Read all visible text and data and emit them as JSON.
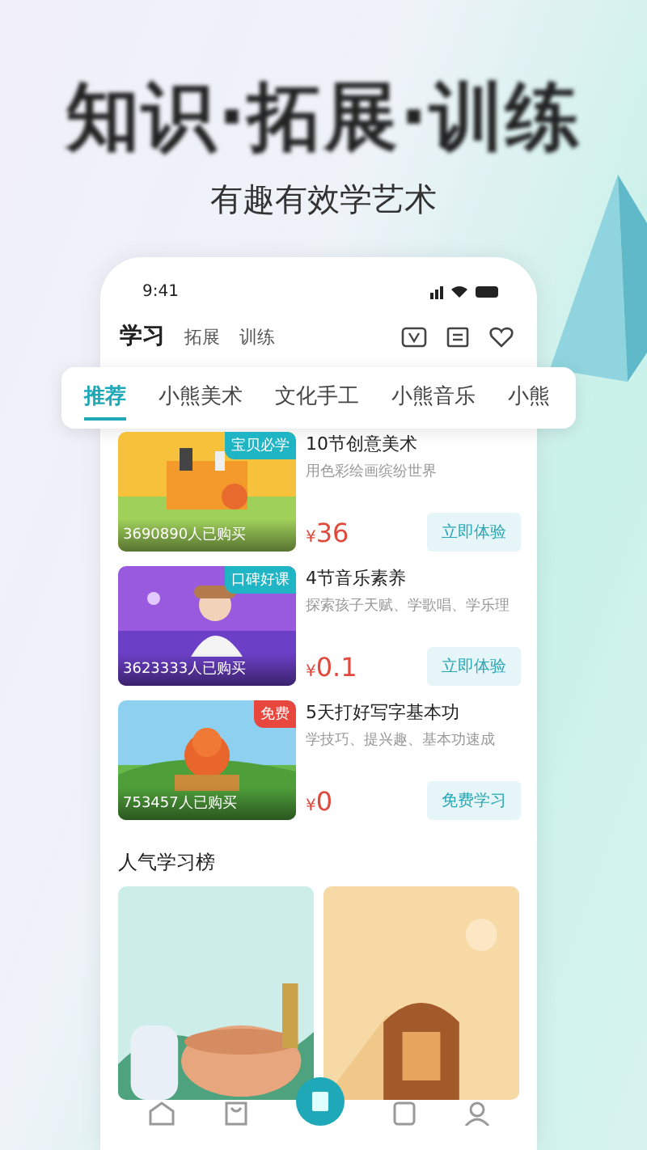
{
  "headline": "知识·拓展·训练",
  "subtitle": "有趣有效学艺术",
  "status_bar": {
    "time": "9:41"
  },
  "top_tabs": [
    {
      "label": "学习",
      "selected": true
    },
    {
      "label": "拓展",
      "selected": false
    },
    {
      "label": "训练",
      "selected": false
    }
  ],
  "categories": [
    {
      "label": "推荐",
      "selected": true
    },
    {
      "label": "小熊美术",
      "selected": false
    },
    {
      "label": "文化手工",
      "selected": false
    },
    {
      "label": "小熊音乐",
      "selected": false
    },
    {
      "label": "小熊",
      "selected": false
    }
  ],
  "courses": [
    {
      "badge": "宝贝必学",
      "color": "#1fb5c4",
      "buyers": "3690890人已购买",
      "title": "10节创意美术",
      "desc": "用色彩绘画缤纷世界",
      "currency": "¥",
      "price": "36",
      "action": "立即体验"
    },
    {
      "badge": "口碑好课",
      "color": "#1fb5c4",
      "buyers": "3623333人已购买",
      "title": "4节音乐素养",
      "desc": "探索孩子天赋、学歌唱、学乐理",
      "currency": "¥",
      "price": "0.1",
      "action": "立即体验"
    },
    {
      "badge": "免费",
      "color": "#e8473e",
      "buyers": "753457人已购买",
      "title": "5天打好写字基本功",
      "desc": "学技巧、提兴趣、基本功速成",
      "currency": "¥",
      "price": "0",
      "action": "免费学习"
    }
  ],
  "ranking": {
    "title": "人气学习榜"
  },
  "bottom_nav": [
    {
      "selected": false
    },
    {
      "selected": false
    },
    {
      "selected": true
    },
    {
      "selected": false
    },
    {
      "selected": false
    }
  ]
}
